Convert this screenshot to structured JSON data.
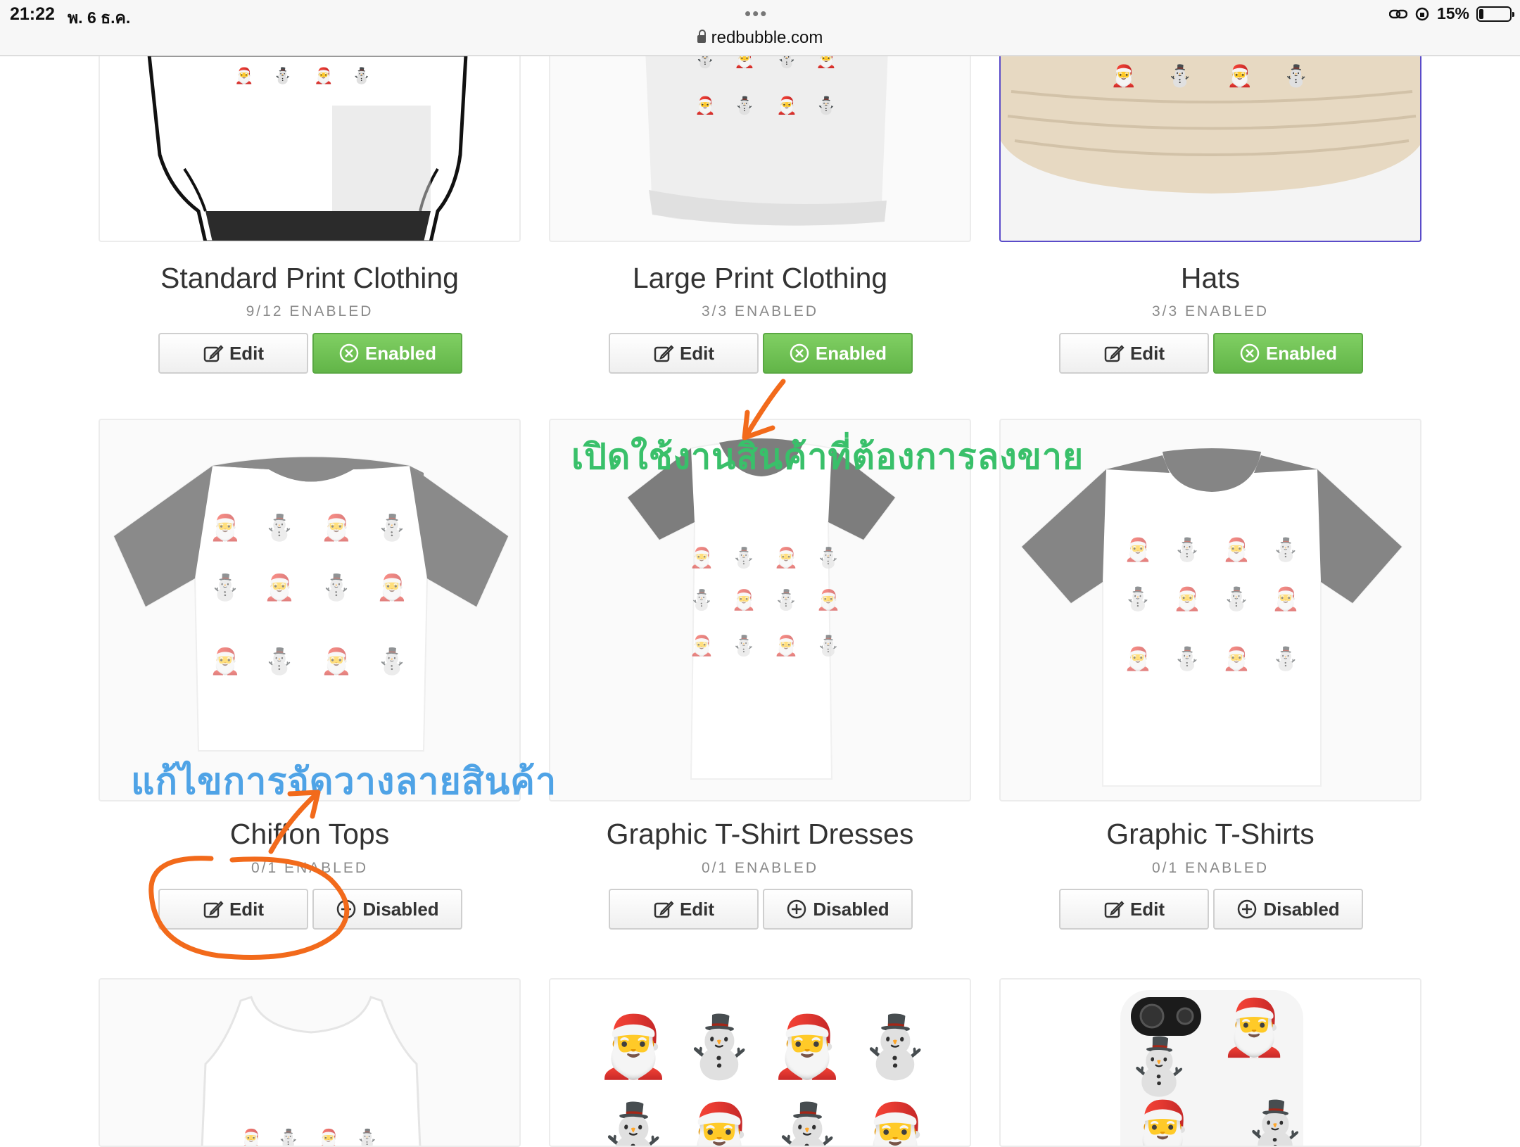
{
  "status_bar": {
    "time": "21:22",
    "date": "พ. 6 ธ.ค.",
    "dots": "•••",
    "battery": "15%",
    "battery_level": 0.15
  },
  "browser": {
    "url": "redbubble.com"
  },
  "colors": {
    "enabled_green": "#6cc04f",
    "selected_border": "#5a4bc9",
    "annotation_orange": "#f26a1b",
    "annotation_green": "#39c06a",
    "annotation_blue": "#4fa3e6"
  },
  "products": [
    {
      "name": "Standard Print Clothing",
      "count": "9/12 ENABLED",
      "edit": "Edit",
      "status": "Enabled",
      "state": "enabled",
      "image": "t-shirt-on-model"
    },
    {
      "name": "Large Print Clothing",
      "count": "3/3 ENABLED",
      "edit": "Edit",
      "status": "Enabled",
      "state": "enabled",
      "image": "t-shirt-large-print"
    },
    {
      "name": "Hats",
      "count": "3/3 ENABLED",
      "edit": "Edit",
      "status": "Enabled",
      "state": "enabled",
      "image": "bucket-hat",
      "selected": true
    },
    {
      "name": "Chiffon Tops",
      "count": "0/1 ENABLED",
      "edit": "Edit",
      "status": "Disabled",
      "state": "disabled",
      "image": "chiffon-top"
    },
    {
      "name": "Graphic T-Shirt Dresses",
      "count": "0/1 ENABLED",
      "edit": "Edit",
      "status": "Disabled",
      "state": "disabled",
      "image": "t-shirt-dress"
    },
    {
      "name": "Graphic T-Shirts",
      "count": "0/1 ENABLED",
      "edit": "Edit",
      "status": "Disabled",
      "state": "disabled",
      "image": "graphic-t-shirt"
    },
    {
      "name": "",
      "count": "",
      "image": "tank-top"
    },
    {
      "name": "",
      "count": "",
      "image": "stickers"
    },
    {
      "name": "",
      "count": "",
      "image": "phone-case"
    }
  ],
  "annotations": {
    "green_text": "เปิดใช้งานสินค้าที่ต้องการลงขาย",
    "blue_text": "แก้ไขการจัดวางลายสินค้า"
  }
}
